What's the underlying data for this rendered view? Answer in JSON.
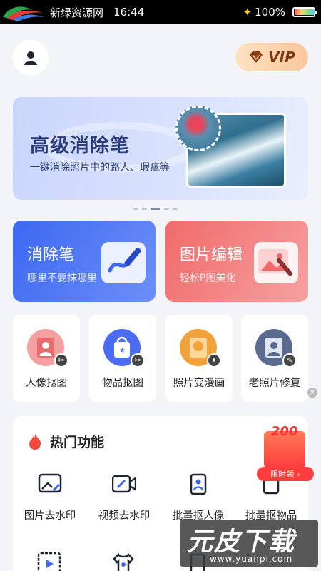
{
  "status_bar": {
    "carrier": "新绿资源网",
    "time": "16:44",
    "battery": "100%"
  },
  "header": {
    "vip_label": "VIP"
  },
  "banner": {
    "title": "高级消除笔",
    "subtitle": "一键消除照片中的路人、瑕疵等"
  },
  "carousel": {
    "count": 5,
    "active": 3
  },
  "feature_cards": [
    {
      "title": "消除笔",
      "desc": "哪里不要抹哪里",
      "icon": "pen-icon"
    },
    {
      "title": "图片编辑",
      "desc": "轻松P图美化",
      "icon": "image-edit-icon"
    }
  ],
  "tools": [
    {
      "label": "人像抠图",
      "icon": "portrait-cutout-icon",
      "color": "#e96a6a"
    },
    {
      "label": "物品抠图",
      "icon": "object-cutout-icon",
      "color": "#4a6cf1"
    },
    {
      "label": "照片变漫画",
      "icon": "cartoon-icon",
      "color": "#f2a23a"
    },
    {
      "label": "老照片修复",
      "icon": "photo-restore-icon",
      "color": "#5b6b8f"
    }
  ],
  "hot": {
    "title": "热门功能",
    "items": [
      {
        "label": "图片去水印",
        "icon": "image-watermark-icon"
      },
      {
        "label": "视频去水印",
        "icon": "video-watermark-icon"
      },
      {
        "label": "批量抠人像",
        "icon": "batch-portrait-icon"
      },
      {
        "label": "批量抠物品",
        "icon": "batch-object-icon"
      }
    ]
  },
  "promo": {
    "amount": "200",
    "label": "限时领"
  },
  "watermark": {
    "text": "元皮下载",
    "url": "www.yuanpi.com"
  },
  "colors": {
    "primary_blue": "#3d68f1",
    "primary_red": "#f16a6a",
    "accent": "#ff3d3d"
  }
}
